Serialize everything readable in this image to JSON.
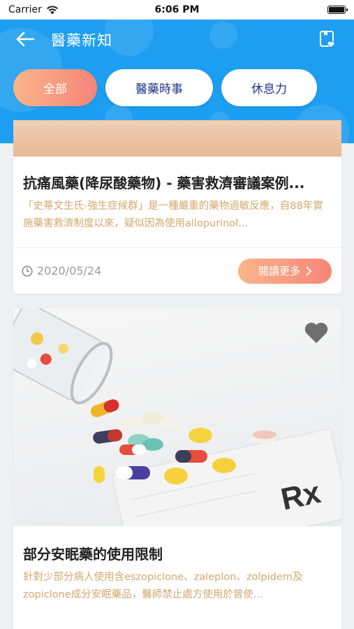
{
  "status_bar": {
    "carrier": "Carrier",
    "time": "6:06 PM"
  },
  "nav": {
    "title": "醫藥新知",
    "back_icon": "arrow-left-icon",
    "fav_icon": "bookmark-heart-icon"
  },
  "tabs": [
    {
      "label": "全部",
      "active": true
    },
    {
      "label": "醫藥時事",
      "active": false
    },
    {
      "label": "休息力",
      "active": false
    }
  ],
  "articles": [
    {
      "title": "抗痛風藥(降尿酸藥物) - 藥害救濟審議案例...",
      "description": "「史蒂文生氏-強生症候群」是一種嚴重的藥物過敏反應，自88年實施藥害救濟制度以來，疑似因為使用allopurinol...",
      "date": "2020/05/24",
      "read_more": "閱讀更多"
    },
    {
      "title": "部分安眠藥的使用限制",
      "description": "針對少部分病人使用含eszopiclone、zaleplon、zolpidem及zopiclone成分安眠藥品，醫師禁止處方使用於曾使..."
    }
  ],
  "colors": {
    "header_blue": "#1e9ef0",
    "accent_start": "#f9b58a",
    "accent_end": "#f6857a",
    "desc_gold": "#d2a86c",
    "tab_text": "#1d3a8a"
  }
}
